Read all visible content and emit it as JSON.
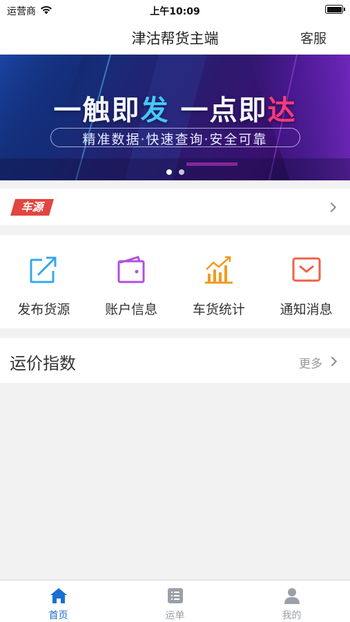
{
  "status_bar": {
    "carrier": "运营商",
    "time": "上午10:09",
    "battery_level": 1.0
  },
  "nav": {
    "title": "津沽帮货主端",
    "right_button": "客服"
  },
  "banner": {
    "title_part1": "一触即",
    "title_part2": "发",
    "title_part3": " 一点即",
    "title_part4": "达",
    "subtitle": "精准数据·快速查询·安全可靠",
    "dots_total": 2,
    "dots_active": 1,
    "accent_blue": "#46c7f7",
    "accent_pink": "#ff3a7a"
  },
  "cheyuan": {
    "tag_label": "车源",
    "tag_color": "#e2453f"
  },
  "quick_actions": [
    {
      "label": "发布货源",
      "icon": "share-external-icon",
      "color": "#33a9e8"
    },
    {
      "label": "账户信息",
      "icon": "wallet-icon",
      "color": "#b04fe0"
    },
    {
      "label": "车货统计",
      "icon": "stats-chart-icon",
      "color": "#f29a1c"
    },
    {
      "label": "通知消息",
      "icon": "mail-icon",
      "color": "#ee6045"
    }
  ],
  "freight_index": {
    "title": "运价指数",
    "more_label": "更多"
  },
  "tab_bar": {
    "active_color": "#1a6fd4",
    "inactive_color": "#9aa0aa",
    "tabs": [
      {
        "label": "首页",
        "icon": "home-icon",
        "active": true
      },
      {
        "label": "运单",
        "icon": "list-icon",
        "active": false
      },
      {
        "label": "我的",
        "icon": "user-icon",
        "active": false
      }
    ]
  }
}
